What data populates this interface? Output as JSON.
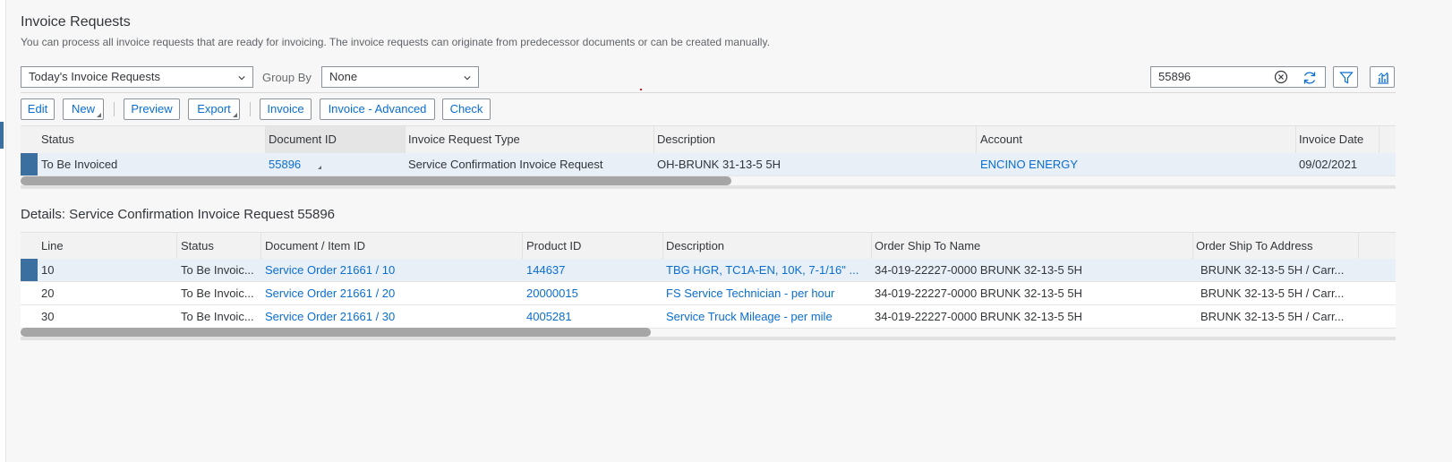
{
  "page": {
    "title": "Invoice Requests",
    "description": "You can process all invoice requests that are ready for invoicing. The invoice requests can originate from predecessor documents or can be created manually."
  },
  "filters": {
    "view_select": "Today's Invoice Requests",
    "group_by_label": "Group By",
    "group_by_value": "None",
    "search_value": "55896"
  },
  "toolbar": {
    "edit": "Edit",
    "new": "New",
    "preview": "Preview",
    "export": "Export",
    "invoice": "Invoice",
    "invoice_advanced": "Invoice - Advanced",
    "check": "Check"
  },
  "main_table": {
    "columns": [
      "Status",
      "Document ID",
      "Invoice Request Type",
      "Description",
      "Account",
      "Invoice Date"
    ],
    "rows": [
      {
        "status": "To Be Invoiced",
        "document_id": "55896",
        "type": "Service Confirmation Invoice Request",
        "description": "OH-BRUNK 31-13-5 5H",
        "account": "ENCINO ENERGY",
        "invoice_date": "09/02/2021"
      }
    ]
  },
  "details": {
    "title": "Details: Service Confirmation Invoice Request 55896",
    "columns": [
      "Line",
      "Status",
      "Document / Item ID",
      "Product ID",
      "Description",
      "Order Ship To Name",
      "Order Ship To Address"
    ],
    "rows": [
      {
        "line": "10",
        "status": "To Be Invoic...",
        "item": "Service Order 21661 / 10",
        "product": "144637",
        "description": "TBG HGR, TC1A-EN, 10K, 7-1/16\" ...",
        "ship_name": "34-019-22227-0000 BRUNK 32-13-5 5H",
        "ship_address": "BRUNK 32-13-5 5H / Carr..."
      },
      {
        "line": "20",
        "status": "To Be Invoic...",
        "item": "Service Order 21661 / 20",
        "product": "20000015",
        "description": "FS Service Technician - per hour",
        "ship_name": "34-019-22227-0000 BRUNK 32-13-5 5H",
        "ship_address": "BRUNK 32-13-5 5H / Carr..."
      },
      {
        "line": "30",
        "status": "To Be Invoic...",
        "item": "Service Order 21661 / 30",
        "product": "4005281",
        "description": "Service Truck Mileage - per mile",
        "ship_name": "34-019-22227-0000 BRUNK 32-13-5 5H",
        "ship_address": "BRUNK 32-13-5 5H / Carr..."
      }
    ]
  },
  "icons": {
    "dropdown": "chevron-down-icon",
    "clear": "clear-circle-icon",
    "refresh": "refresh-icon",
    "filter": "filter-icon",
    "settings": "table-settings-icon"
  },
  "colors": {
    "link": "#0a6ed1",
    "selection": "#3b6f9f",
    "selected_row": "#e8eff6"
  }
}
